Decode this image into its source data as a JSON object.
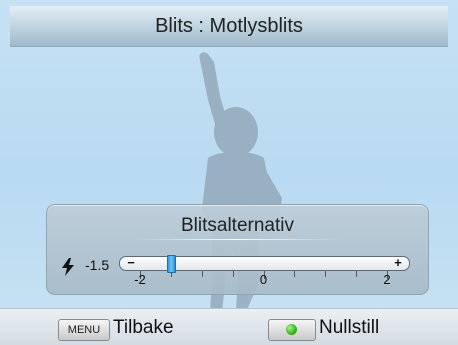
{
  "header": {
    "title": "Blits : Motlysblits"
  },
  "panel": {
    "title": "Blitsalternativ",
    "flash_icon": "flash-icon",
    "current_value_label": "-1.5",
    "slider": {
      "min": -2,
      "max": 2,
      "value": -1.5,
      "minus_symbol": "−",
      "plus_symbol": "+",
      "scale_labels": [
        "-2",
        "0",
        "2"
      ]
    }
  },
  "footer": {
    "menu_key": "MENU",
    "back_label": "Tilbake",
    "ok_key_icon": "green-dot-icon",
    "reset_label": "Nullstill"
  },
  "colors": {
    "background": "#b8daf2",
    "slider_thumb": "#2f9be3",
    "ok_dot": "#34b51c"
  }
}
